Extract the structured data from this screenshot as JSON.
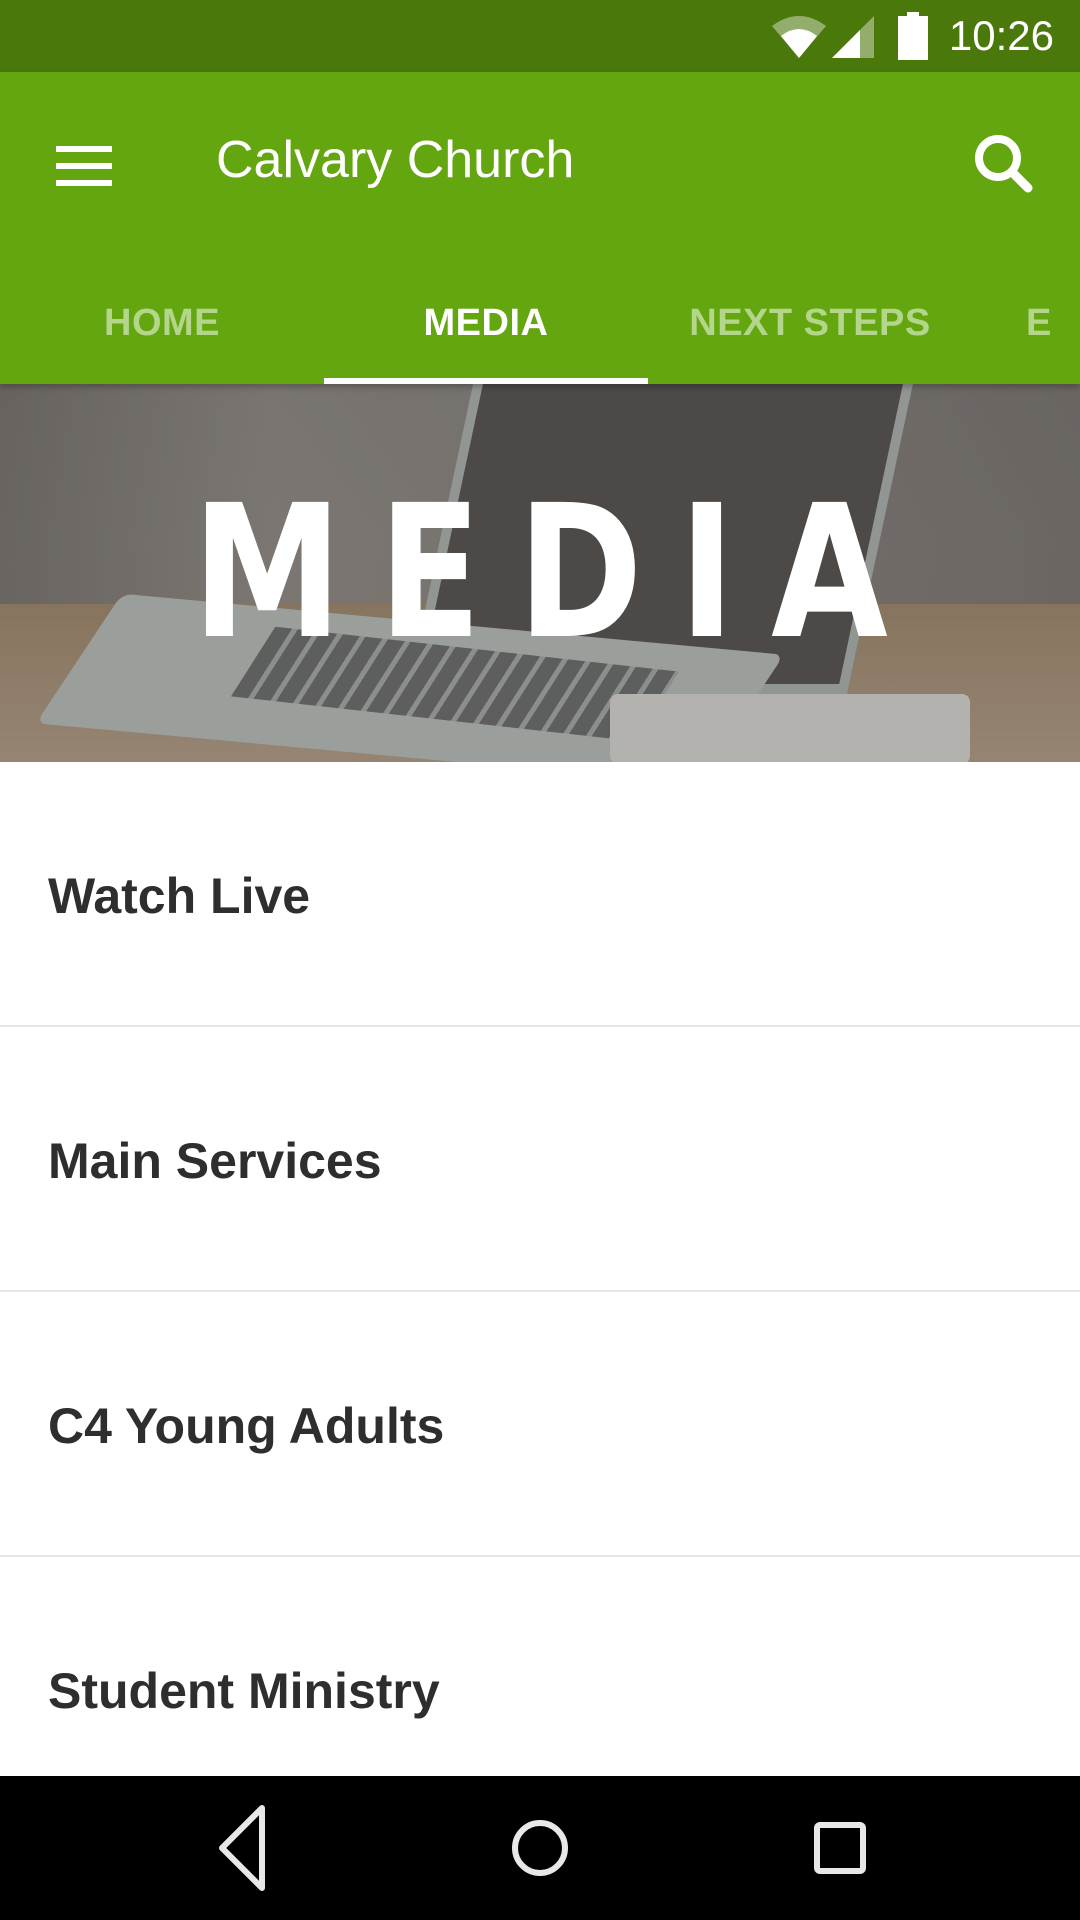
{
  "status_bar": {
    "time": "10:26",
    "icons": [
      "wifi-icon",
      "cell-signal-icon",
      "battery-icon"
    ]
  },
  "app_bar": {
    "title": "Calvary Church",
    "menu_icon": "hamburger-menu-icon",
    "search_icon": "search-icon"
  },
  "tabs": [
    {
      "label": "HOME",
      "active": false
    },
    {
      "label": "MEDIA",
      "active": true
    },
    {
      "label": "NEXT STEPS",
      "active": false
    },
    {
      "label": "E",
      "active": false
    }
  ],
  "hero": {
    "title": "MEDIA"
  },
  "list": {
    "items": [
      {
        "label": "Watch Live"
      },
      {
        "label": "Main Services"
      },
      {
        "label": "C4 Young Adults"
      },
      {
        "label": "Student Ministry"
      }
    ]
  },
  "nav_bar": {
    "buttons": [
      "back-icon",
      "home-icon",
      "recents-icon"
    ]
  },
  "colors": {
    "status_bar": "#4b780b",
    "app_bar": "#64a60f",
    "tab_inactive": "#b3d68a",
    "tab_active": "#ffffff",
    "list_text": "#2e2e2e"
  }
}
